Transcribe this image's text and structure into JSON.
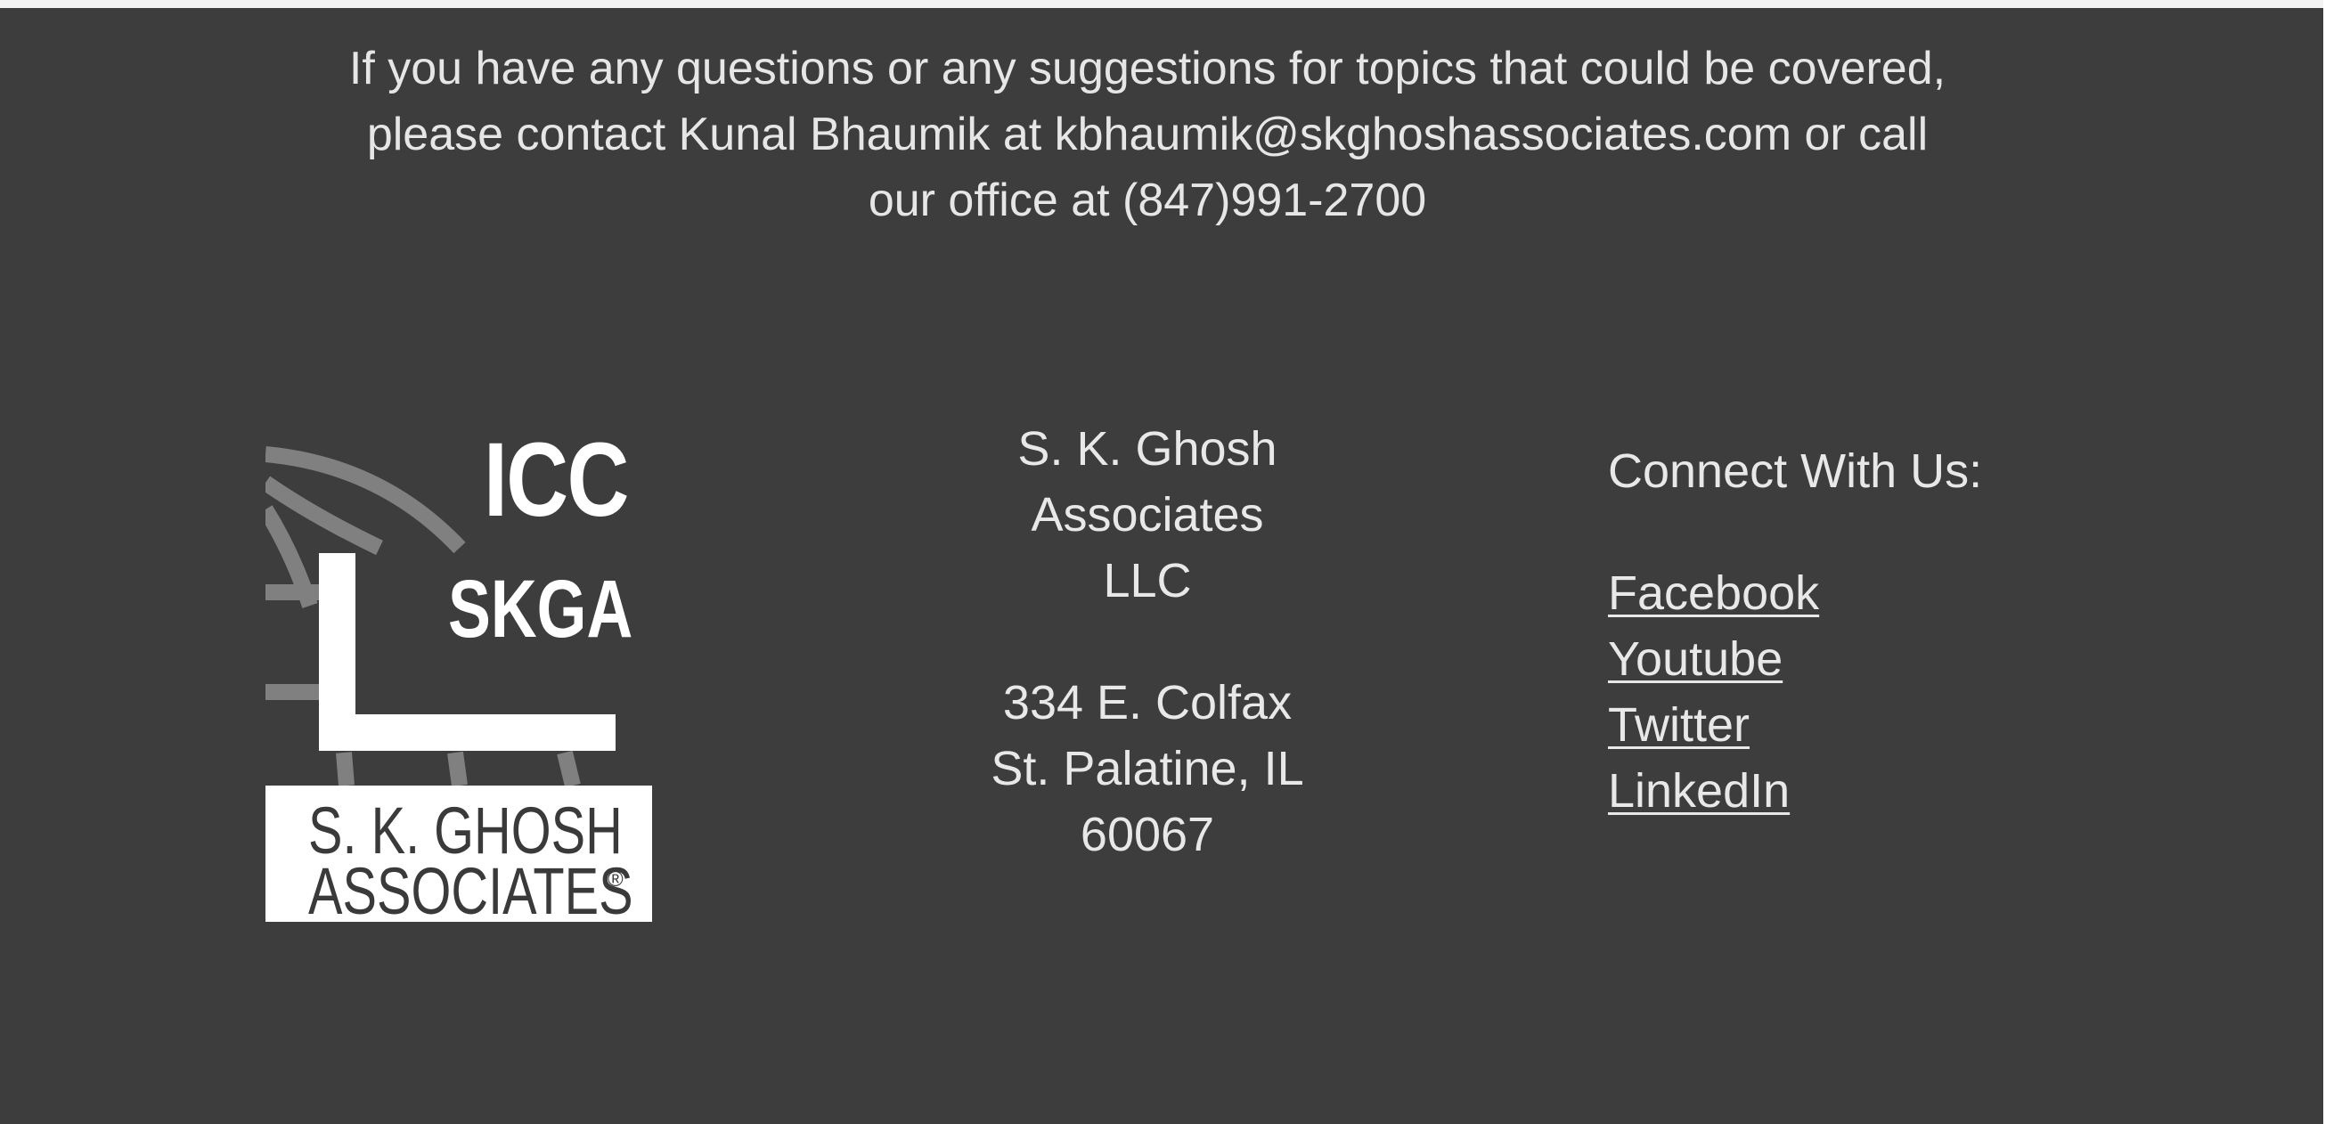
{
  "contact": {
    "line1": "If you have any questions or any suggestions for topics that could be covered,",
    "line2": "please contact Kunal Bhaumik at kbhaumik@skghoshassociates.com or call",
    "line3": "our office at (847)991-2700"
  },
  "logo": {
    "icc": "ICC",
    "skga": "SKGA",
    "name_line1": "S. K. GHOSH",
    "name_line2": "ASSOCIATES",
    "registered": "®"
  },
  "address": {
    "company": [
      "S. K. Ghosh",
      "Associates",
      "LLC"
    ],
    "street": [
      "334 E. Colfax",
      "St. Palatine, IL",
      "60067"
    ]
  },
  "social": {
    "heading": "Connect With Us:",
    "links": [
      {
        "label": "Facebook"
      },
      {
        "label": "Youtube"
      },
      {
        "label": "Twitter"
      },
      {
        "label": "LinkedIn"
      }
    ]
  },
  "colors": {
    "background": "#3d3d3d",
    "text": "#e8e8e8",
    "logo_graphic": "#808080",
    "logo_white": "#ffffff"
  }
}
